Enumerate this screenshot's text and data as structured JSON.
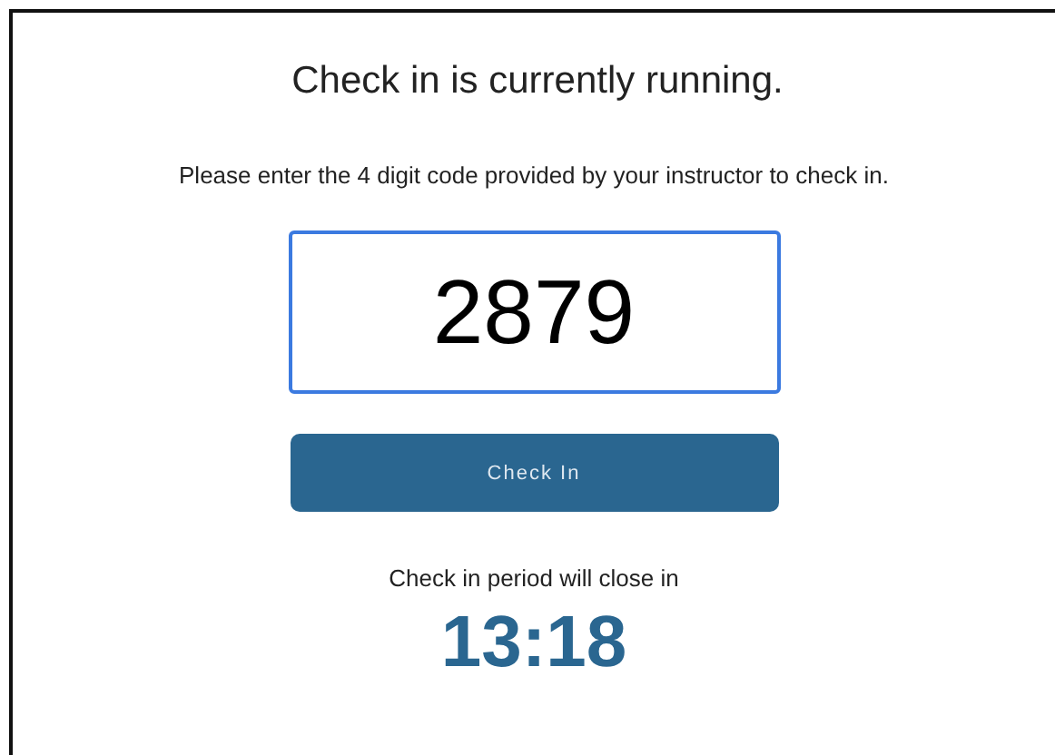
{
  "heading": "Check in is currently running.",
  "instruction": "Please enter the 4 digit code provided by your instructor to check in.",
  "code_field": {
    "value": "2879",
    "focused": true
  },
  "submit_button": "Check In",
  "countdown": {
    "label": "Check in period will close in",
    "time": "13:18"
  }
}
